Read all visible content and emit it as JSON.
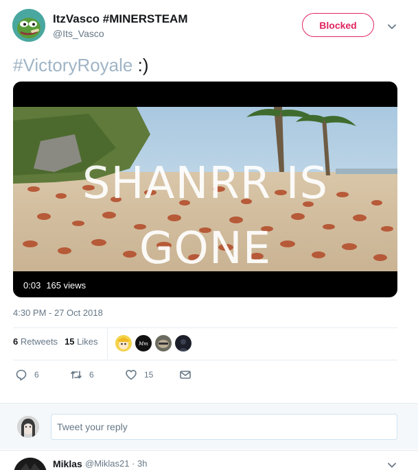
{
  "tweet": {
    "display_name": "ItzVasco #MINERSTEAM",
    "handle": "@Its_Vasco",
    "blocked_label": "Blocked",
    "text_hashtag": "#VictoryRoyale",
    "text_rest": " :)",
    "timestamp": "4:30 PM - 27 Oct 2018"
  },
  "video": {
    "overlay_line1": "SHANRR IS",
    "overlay_line2": "GONE",
    "duration": "0:03",
    "views": "165 views"
  },
  "stats": {
    "retweets_count": "6",
    "retweets_label": "Retweets",
    "likes_count": "15",
    "likes_label": "Likes"
  },
  "actions": {
    "reply_count": "6",
    "retweet_count": "6",
    "like_count": "15"
  },
  "reply": {
    "placeholder": "Tweet your reply"
  },
  "next_tweet": {
    "name": "Miklas",
    "meta": "@Miklas21 · 3h"
  },
  "liker_labels": {
    "second": "Mm"
  },
  "colors": {
    "blocked": "#e0245e",
    "hashtag": "#9fb4c6",
    "secondary_text": "#657786",
    "avatar_bg": "#4aa7a0"
  }
}
